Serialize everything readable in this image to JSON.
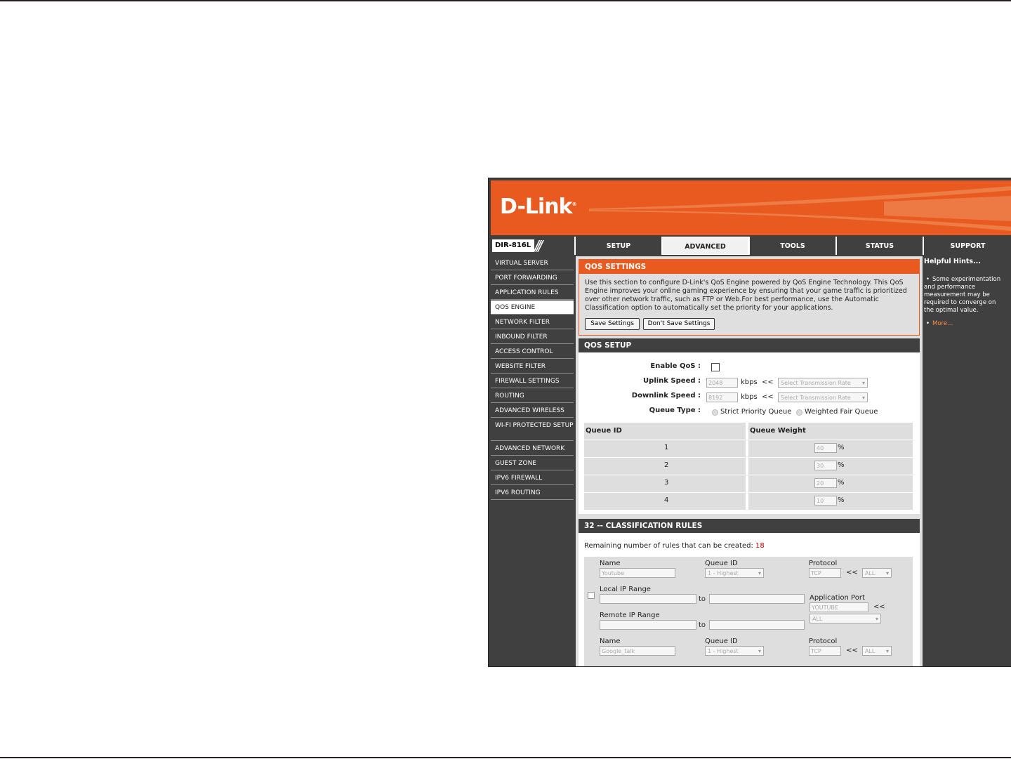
{
  "brand": {
    "logo": "D-Link",
    "registered": "®",
    "model": "DIR-816L"
  },
  "colors": {
    "brand_orange": "#e85a1f",
    "nav_dark": "#404040",
    "panel_gray": "#dfdfdf",
    "count_red": "#cc0000"
  },
  "nav": {
    "tabs": [
      {
        "label": "SETUP",
        "active": false
      },
      {
        "label": "ADVANCED",
        "active": true
      },
      {
        "label": "TOOLS",
        "active": false
      },
      {
        "label": "STATUS",
        "active": false
      },
      {
        "label": "SUPPORT",
        "active": false
      }
    ]
  },
  "sidebar": {
    "items": [
      {
        "label": "VIRTUAL SERVER"
      },
      {
        "label": "PORT FORWARDING"
      },
      {
        "label": "APPLICATION RULES"
      },
      {
        "label": "QOS ENGINE",
        "active": true
      },
      {
        "label": "NETWORK FILTER"
      },
      {
        "label": "INBOUND FILTER"
      },
      {
        "label": "ACCESS CONTROL"
      },
      {
        "label": "WEBSITE FILTER"
      },
      {
        "label": "FIREWALL SETTINGS"
      },
      {
        "label": "ROUTING"
      },
      {
        "label": "ADVANCED WIRELESS"
      },
      {
        "label": "WI-FI PROTECTED SETUP"
      },
      {
        "label": "ADVANCED NETWORK"
      },
      {
        "label": "GUEST ZONE"
      },
      {
        "label": "IPV6 FIREWALL"
      },
      {
        "label": "IPV6 ROUTING"
      }
    ]
  },
  "qos_settings": {
    "title": "QOS SETTINGS",
    "description": "Use this section to configure D-Link's QoS Engine powered by QoS Engine Technology. This QoS Engine improves your online gaming experience by ensuring that your game traffic is prioritized over other network traffic, such as FTP or Web.For best performance, use the Automatic Classification option to automatically set the priority for your applications.",
    "save_label": "Save Settings",
    "dont_save_label": "Don't Save Settings"
  },
  "qos_setup": {
    "title": "QOS SETUP",
    "enable_label": "Enable QoS :",
    "enable_checked": false,
    "uplink_label": "Uplink Speed :",
    "uplink_value": "2048",
    "downlink_label": "Downlink Speed :",
    "downlink_value": "8192",
    "unit": "kbps",
    "arrows": "<<",
    "rate_select": "Select Transmission Rate",
    "queue_type_label": "Queue Type :",
    "queue_options": [
      "Strict Priority Queue",
      "Weighted Fair Queue"
    ],
    "queue_selected": "Weighted Fair Queue",
    "table": {
      "headers": [
        "Queue ID",
        "Queue Weight"
      ],
      "rows": [
        {
          "id": "1",
          "weight": "40"
        },
        {
          "id": "2",
          "weight": "30"
        },
        {
          "id": "3",
          "weight": "20"
        },
        {
          "id": "4",
          "weight": "10"
        }
      ],
      "percent": "%"
    }
  },
  "classification": {
    "title": "32 -- CLASSIFICATION RULES",
    "remaining_label": "Remaining number of rules that can be created:",
    "remaining_count": "18",
    "labels": {
      "name": "Name",
      "queue_id": "Queue ID",
      "protocol": "Protocol",
      "local_ip": "Local IP Range",
      "remote_ip": "Remote IP Range",
      "app_port": "Application Port",
      "to": "to",
      "arrows": "<<"
    },
    "rules": [
      {
        "name": "Youtube",
        "queue": "1 - Highest",
        "protocol": "TCP",
        "protocol_select": "ALL",
        "app_port": "YOUTUBE",
        "app_select": "ALL",
        "checked": true
      },
      {
        "name": "Google_talk",
        "queue": "1 - Highest",
        "protocol": "TCP",
        "protocol_select": "ALL"
      }
    ]
  },
  "hints": {
    "title": "Helpful Hints...",
    "bullet": "Some experimentation and performance measurement may be required to converge on the optimal value.",
    "more": "More..."
  }
}
